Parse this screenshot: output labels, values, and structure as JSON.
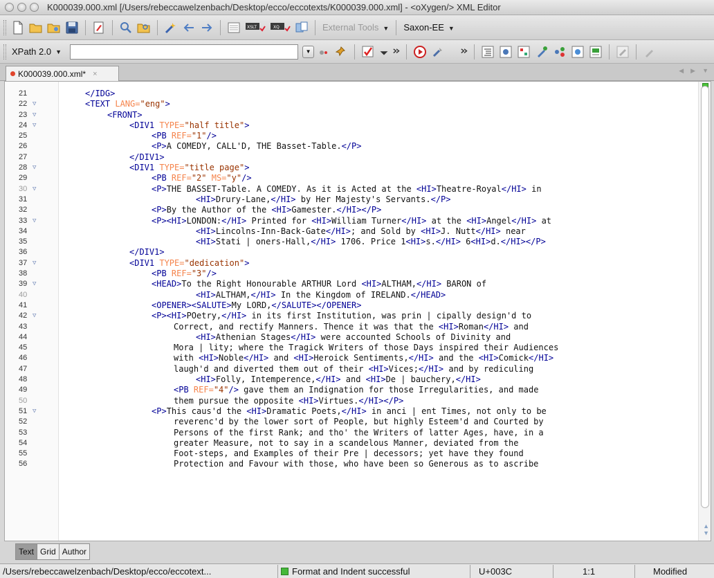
{
  "window": {
    "title": "K000039.000.xml [/Users/rebeccawelzenbach/Desktop/ecco/eccotexts/K000039.000.xml] - <oXygen/> XML Editor"
  },
  "toolbar": {
    "external_tools": "External Tools",
    "transformer": "Saxon-EE",
    "xpath_version": "XPath 2.0",
    "xpath_value": ""
  },
  "tabs": {
    "file_tab": "K000039.000.xml*",
    "close_glyph": "×"
  },
  "editor": {
    "lines": [
      {
        "n": "21",
        "fold": false,
        "dim": false,
        "indent": 1,
        "parts": [
          [
            "t",
            "</IDG>"
          ]
        ]
      },
      {
        "n": "22",
        "fold": true,
        "dim": false,
        "indent": 1,
        "parts": [
          [
            "t",
            "<TEXT "
          ],
          [
            "a",
            "LANG="
          ],
          [
            "v",
            "\"eng\""
          ],
          [
            "t",
            ">"
          ]
        ]
      },
      {
        "n": "23",
        "fold": true,
        "dim": false,
        "indent": 2,
        "parts": [
          [
            "t",
            "<FRONT>"
          ]
        ]
      },
      {
        "n": "24",
        "fold": true,
        "dim": false,
        "indent": 3,
        "parts": [
          [
            "t",
            "<DIV1 "
          ],
          [
            "a",
            "TYPE="
          ],
          [
            "v",
            "\"half title\""
          ],
          [
            "t",
            ">"
          ]
        ]
      },
      {
        "n": "25",
        "fold": false,
        "dim": false,
        "indent": 4,
        "parts": [
          [
            "t",
            "<PB "
          ],
          [
            "a",
            "REF="
          ],
          [
            "v",
            "\"1\""
          ],
          [
            "t",
            "/>"
          ]
        ]
      },
      {
        "n": "26",
        "fold": false,
        "dim": false,
        "indent": 4,
        "parts": [
          [
            "t",
            "<P>"
          ],
          [
            "x",
            "A COMEDY, CALL'D, THE Basset-Table."
          ],
          [
            "t",
            "</P>"
          ]
        ]
      },
      {
        "n": "27",
        "fold": false,
        "dim": false,
        "indent": 3,
        "parts": [
          [
            "t",
            "</DIV1>"
          ]
        ]
      },
      {
        "n": "28",
        "fold": true,
        "dim": false,
        "indent": 3,
        "parts": [
          [
            "t",
            "<DIV1 "
          ],
          [
            "a",
            "TYPE="
          ],
          [
            "v",
            "\"title page\""
          ],
          [
            "t",
            ">"
          ]
        ]
      },
      {
        "n": "29",
        "fold": false,
        "dim": false,
        "indent": 4,
        "parts": [
          [
            "t",
            "<PB "
          ],
          [
            "a",
            "REF="
          ],
          [
            "v",
            "\"2\""
          ],
          [
            "a",
            " MS="
          ],
          [
            "v",
            "\"y\""
          ],
          [
            "t",
            "/>"
          ]
        ]
      },
      {
        "n": "30",
        "fold": true,
        "dim": true,
        "indent": 4,
        "parts": [
          [
            "t",
            "<P>"
          ],
          [
            "x",
            "THE BASSET-Table. A COMEDY. As it is Acted at the "
          ],
          [
            "t",
            "<HI>"
          ],
          [
            "x",
            "Theatre-Royal"
          ],
          [
            "t",
            "</HI>"
          ],
          [
            "x",
            " in"
          ]
        ]
      },
      {
        "n": "31",
        "fold": false,
        "dim": false,
        "indent": 6,
        "parts": [
          [
            "t",
            "<HI>"
          ],
          [
            "x",
            "Drury-Lane,"
          ],
          [
            "t",
            "</HI>"
          ],
          [
            "x",
            " by Her Majesty's Servants."
          ],
          [
            "t",
            "</P>"
          ]
        ]
      },
      {
        "n": "32",
        "fold": false,
        "dim": false,
        "indent": 4,
        "parts": [
          [
            "t",
            "<P>"
          ],
          [
            "x",
            "By the Author of the "
          ],
          [
            "t",
            "<HI>"
          ],
          [
            "x",
            "Gamester."
          ],
          [
            "t",
            "</HI></P>"
          ]
        ]
      },
      {
        "n": "33",
        "fold": true,
        "dim": false,
        "indent": 4,
        "parts": [
          [
            "t",
            "<P><HI>"
          ],
          [
            "x",
            "LONDON:"
          ],
          [
            "t",
            "</HI>"
          ],
          [
            "x",
            " Printed for "
          ],
          [
            "t",
            "<HI>"
          ],
          [
            "x",
            "William Turner"
          ],
          [
            "t",
            "</HI>"
          ],
          [
            "x",
            " at the "
          ],
          [
            "t",
            "<HI>"
          ],
          [
            "x",
            "Angel"
          ],
          [
            "t",
            "</HI>"
          ],
          [
            "x",
            " at"
          ]
        ]
      },
      {
        "n": "34",
        "fold": false,
        "dim": false,
        "indent": 6,
        "parts": [
          [
            "t",
            "<HI>"
          ],
          [
            "x",
            "Lincolns-Inn-Back-Gate"
          ],
          [
            "t",
            "</HI>"
          ],
          [
            "x",
            "; and Sold by "
          ],
          [
            "t",
            "<HI>"
          ],
          [
            "x",
            "J. Nutt"
          ],
          [
            "t",
            "</HI>"
          ],
          [
            "x",
            " near"
          ]
        ]
      },
      {
        "n": "35",
        "fold": false,
        "dim": false,
        "indent": 6,
        "parts": [
          [
            "t",
            "<HI>"
          ],
          [
            "x",
            "Stati | oners-Hall,"
          ],
          [
            "t",
            "</HI>"
          ],
          [
            "x",
            " 1706. Price 1"
          ],
          [
            "t",
            "<HI>"
          ],
          [
            "x",
            "s."
          ],
          [
            "t",
            "</HI>"
          ],
          [
            "x",
            " 6"
          ],
          [
            "t",
            "<HI>"
          ],
          [
            "x",
            "d."
          ],
          [
            "t",
            "</HI></P>"
          ]
        ]
      },
      {
        "n": "36",
        "fold": false,
        "dim": false,
        "indent": 3,
        "parts": [
          [
            "t",
            "</DIV1>"
          ]
        ]
      },
      {
        "n": "37",
        "fold": true,
        "dim": false,
        "indent": 3,
        "parts": [
          [
            "t",
            "<DIV1 "
          ],
          [
            "a",
            "TYPE="
          ],
          [
            "v",
            "\"dedication\""
          ],
          [
            "t",
            ">"
          ]
        ]
      },
      {
        "n": "38",
        "fold": false,
        "dim": false,
        "indent": 4,
        "parts": [
          [
            "t",
            "<PB "
          ],
          [
            "a",
            "REF="
          ],
          [
            "v",
            "\"3\""
          ],
          [
            "t",
            "/>"
          ]
        ]
      },
      {
        "n": "39",
        "fold": true,
        "dim": false,
        "indent": 4,
        "parts": [
          [
            "t",
            "<HEAD>"
          ],
          [
            "x",
            "To the Right Honourable ARTHUR Lord "
          ],
          [
            "t",
            "<HI>"
          ],
          [
            "x",
            "ALTHAM,"
          ],
          [
            "t",
            "</HI>"
          ],
          [
            "x",
            " BARON of"
          ]
        ]
      },
      {
        "n": "40",
        "fold": false,
        "dim": true,
        "indent": 6,
        "parts": [
          [
            "t",
            "<HI>"
          ],
          [
            "x",
            "ALTHAM,"
          ],
          [
            "t",
            "</HI>"
          ],
          [
            "x",
            " In the Kingdom of IRELAND."
          ],
          [
            "t",
            "</HEAD>"
          ]
        ]
      },
      {
        "n": "41",
        "fold": false,
        "dim": false,
        "indent": 4,
        "parts": [
          [
            "t",
            "<OPENER><SALUTE>"
          ],
          [
            "x",
            "My LORD,"
          ],
          [
            "t",
            "</SALUTE></OPENER>"
          ]
        ]
      },
      {
        "n": "42",
        "fold": true,
        "dim": false,
        "indent": 4,
        "parts": [
          [
            "t",
            "<P><HI>"
          ],
          [
            "x",
            "POetry,"
          ],
          [
            "t",
            "</HI>"
          ],
          [
            "x",
            " in its first Institution, was prin | cipally design'd to"
          ]
        ]
      },
      {
        "n": "43",
        "fold": false,
        "dim": false,
        "indent": 5,
        "parts": [
          [
            "x",
            "Correct, and rectify Manners. Thence it was that the "
          ],
          [
            "t",
            "<HI>"
          ],
          [
            "x",
            "Roman"
          ],
          [
            "t",
            "</HI>"
          ],
          [
            "x",
            " and"
          ]
        ]
      },
      {
        "n": "44",
        "fold": false,
        "dim": false,
        "indent": 6,
        "parts": [
          [
            "t",
            "<HI>"
          ],
          [
            "x",
            "Athenian Stages"
          ],
          [
            "t",
            "</HI>"
          ],
          [
            "x",
            " were accounted Schools of Divinity and"
          ]
        ]
      },
      {
        "n": "45",
        "fold": false,
        "dim": false,
        "indent": 5,
        "parts": [
          [
            "x",
            "Mora | lity; where the Tragick Writers of those Days inspired their Audiences"
          ]
        ]
      },
      {
        "n": "46",
        "fold": false,
        "dim": false,
        "indent": 5,
        "parts": [
          [
            "x",
            "with "
          ],
          [
            "t",
            "<HI>"
          ],
          [
            "x",
            "Noble"
          ],
          [
            "t",
            "</HI>"
          ],
          [
            "x",
            " and "
          ],
          [
            "t",
            "<HI>"
          ],
          [
            "x",
            "Heroick Sentiments,"
          ],
          [
            "t",
            "</HI>"
          ],
          [
            "x",
            " and the "
          ],
          [
            "t",
            "<HI>"
          ],
          [
            "x",
            "Comick"
          ],
          [
            "t",
            "</HI>"
          ]
        ]
      },
      {
        "n": "47",
        "fold": false,
        "dim": false,
        "indent": 5,
        "parts": [
          [
            "x",
            "laugh'd and diverted them out of their "
          ],
          [
            "t",
            "<HI>"
          ],
          [
            "x",
            "Vices;"
          ],
          [
            "t",
            "</HI>"
          ],
          [
            "x",
            " and by rediculing"
          ]
        ]
      },
      {
        "n": "48",
        "fold": false,
        "dim": false,
        "indent": 6,
        "parts": [
          [
            "t",
            "<HI>"
          ],
          [
            "x",
            "Folly, Intemperence,"
          ],
          [
            "t",
            "</HI>"
          ],
          [
            "x",
            " and "
          ],
          [
            "t",
            "<HI>"
          ],
          [
            "x",
            "De | bauchery,"
          ],
          [
            "t",
            "</HI>"
          ]
        ]
      },
      {
        "n": "49",
        "fold": false,
        "dim": false,
        "indent": 5,
        "parts": [
          [
            "t",
            "<PB "
          ],
          [
            "a",
            "REF="
          ],
          [
            "v",
            "\"4\""
          ],
          [
            "t",
            "/>"
          ],
          [
            "x",
            " gave them an Indignation for those Irregularities, and made"
          ]
        ]
      },
      {
        "n": "50",
        "fold": false,
        "dim": true,
        "indent": 5,
        "parts": [
          [
            "x",
            "them pursue the opposite "
          ],
          [
            "t",
            "<HI>"
          ],
          [
            "x",
            "Virtues."
          ],
          [
            "t",
            "</HI></P>"
          ]
        ]
      },
      {
        "n": "51",
        "fold": true,
        "dim": false,
        "indent": 4,
        "parts": [
          [
            "t",
            "<P>"
          ],
          [
            "x",
            "This caus'd the "
          ],
          [
            "t",
            "<HI>"
          ],
          [
            "x",
            "Dramatic Poets,"
          ],
          [
            "t",
            "</HI>"
          ],
          [
            "x",
            " in anci | ent Times, not only to be"
          ]
        ]
      },
      {
        "n": "52",
        "fold": false,
        "dim": false,
        "indent": 5,
        "parts": [
          [
            "x",
            "reverenc'd by the lower sort of People, but highly Esteem'd and Courted by"
          ]
        ]
      },
      {
        "n": "53",
        "fold": false,
        "dim": false,
        "indent": 5,
        "parts": [
          [
            "x",
            "Persons of the first Rank; and tho' the Writers of latter Ages, have, in a"
          ]
        ]
      },
      {
        "n": "54",
        "fold": false,
        "dim": false,
        "indent": 5,
        "parts": [
          [
            "x",
            "greater Measure, not to say in a scandelous Manner, deviated from the"
          ]
        ]
      },
      {
        "n": "55",
        "fold": false,
        "dim": false,
        "indent": 5,
        "parts": [
          [
            "x",
            "Foot-steps, and Examples of their Pre | decessors; yet have they found"
          ]
        ]
      },
      {
        "n": "56",
        "fold": false,
        "dim": false,
        "indent": 5,
        "parts": [
          [
            "x",
            "Protection and Favour with those, who have been so Generous as to ascribe"
          ]
        ]
      }
    ]
  },
  "modes": [
    "Text",
    "Grid",
    "Author"
  ],
  "active_mode": "Text",
  "status": {
    "path": "/Users/rebeccawelzenbach/Desktop/ecco/eccotext...",
    "message": "Format and Indent successful",
    "unicode": "U+003C",
    "position": "1:1",
    "state": "Modified"
  },
  "colors": {
    "tag": "#000096",
    "attribute": "#f5844c",
    "value": "#993300",
    "modified_dot": "#e0452c",
    "ok_indicator": "#4cc43a"
  }
}
